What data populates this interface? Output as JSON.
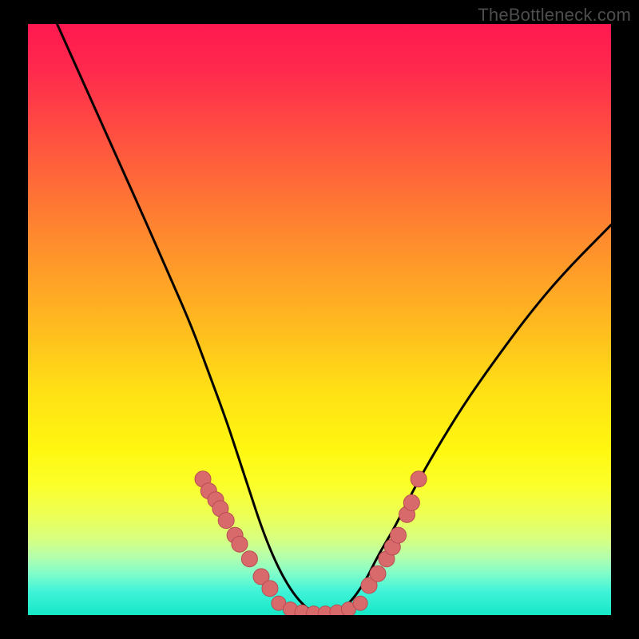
{
  "watermark": {
    "text": "TheBottleneck.com"
  },
  "colors": {
    "curve": "#000000",
    "cluster_fill": "#d96a6c",
    "cluster_stroke": "#b84c52"
  },
  "chart_data": {
    "type": "line",
    "title": "",
    "xlabel": "",
    "ylabel": "",
    "xlim": [
      0,
      100
    ],
    "ylim": [
      0,
      100
    ],
    "grid": false,
    "legend": false,
    "note": "Bottleneck V-curve. Y interpreted as bottleneck percentage (0 at flat bottom, ~100 at top). X is relative hardware balance position (arbitrary 0–100). Values estimated from pixel positions; axes are unlabeled in the image.",
    "series": [
      {
        "name": "bottleneck-curve",
        "x": [
          5,
          10,
          15,
          20,
          24,
          28,
          31,
          34,
          36,
          38,
          40,
          42,
          44,
          46,
          48,
          50,
          52,
          54,
          56,
          58,
          60,
          63,
          66,
          70,
          75,
          80,
          86,
          92,
          100
        ],
        "y": [
          100,
          89,
          78,
          67,
          58,
          49,
          41,
          33,
          27,
          21,
          15,
          10,
          6,
          3,
          1,
          0,
          0,
          1,
          3,
          6,
          10,
          15,
          21,
          28,
          36,
          43,
          51,
          58,
          66
        ]
      },
      {
        "name": "cluster-points-left-arm",
        "x": [
          30.0,
          31.0,
          32.2,
          33.0,
          34.0,
          35.5,
          36.3,
          38.0,
          40.0,
          41.5
        ],
        "y": [
          23.0,
          21.0,
          19.5,
          18.0,
          16.0,
          13.5,
          12.0,
          9.5,
          6.5,
          4.5
        ]
      },
      {
        "name": "cluster-points-bottom",
        "x": [
          43.0,
          45.0,
          47.0,
          49.0,
          51.0,
          53.0,
          55.0,
          57.0
        ],
        "y": [
          2.0,
          1.0,
          0.5,
          0.3,
          0.3,
          0.5,
          1.0,
          2.0
        ]
      },
      {
        "name": "cluster-points-right-arm",
        "x": [
          58.5,
          60.0,
          61.5,
          62.5,
          63.5,
          65.0,
          65.8,
          67.0
        ],
        "y": [
          5.0,
          7.0,
          9.5,
          11.5,
          13.5,
          17.0,
          19.0,
          23.0
        ]
      }
    ]
  }
}
